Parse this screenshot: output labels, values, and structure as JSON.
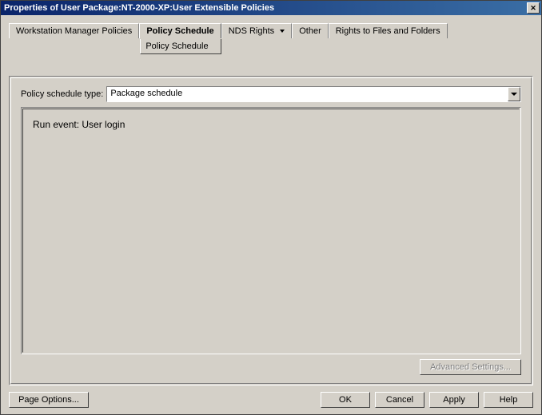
{
  "window": {
    "title": "Properties of User Package:NT-2000-XP:User Extensible Policies"
  },
  "tabs": {
    "workstation": "Workstation Manager Policies",
    "policy_schedule": "Policy Schedule",
    "policy_schedule_sub": "Policy Schedule",
    "nds_rights": "NDS Rights",
    "other": "Other",
    "rights_files": "Rights to Files and Folders"
  },
  "panel": {
    "schedule_type_label": "Policy schedule type:",
    "schedule_type_value": "Package schedule",
    "run_event_text": "Run event: User login",
    "advanced_settings": "Advanced Settings..."
  },
  "buttons": {
    "page_options": "Page Options...",
    "ok": "OK",
    "cancel": "Cancel",
    "apply": "Apply",
    "help": "Help"
  }
}
